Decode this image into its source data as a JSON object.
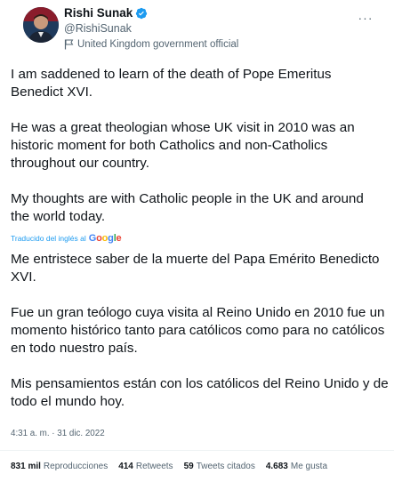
{
  "author": {
    "display_name": "Rishi Sunak",
    "handle": "@RishiSunak",
    "label": "United Kingdom government official",
    "verified": true
  },
  "icons": {
    "verified": "verified-badge-icon",
    "label": "flag-icon",
    "more": "more-icon"
  },
  "tweet": {
    "text": "I am saddened to learn of the death of Pope Emeritus Benedict XVI.\n\nHe was a great theologian whose UK visit in 2010 was an historic moment for both Catholics and non-Catholics throughout our country.\n\nMy thoughts are with Catholic people in the UK and around the world today.",
    "translated_by_label": "Traducido del inglés al",
    "translation_service": "Google",
    "translation": "Me entristece saber de la muerte del Papa Emérito Benedicto XVI.\n\nFue un gran teólogo cuya visita al Reino Unido en 2010 fue un momento histórico tanto para católicos como para no católicos en todo nuestro país.\n\nMis pensamientos están con los católicos del Reino Unido y de todo el mundo hoy.",
    "timestamp": "4:31 a. m. · 31 dic. 2022"
  },
  "stats": [
    {
      "value": "831 mil",
      "label": "Reproducciones"
    },
    {
      "value": "414",
      "label": "Retweets"
    },
    {
      "value": "59",
      "label": "Tweets citados"
    },
    {
      "value": "4.683",
      "label": "Me gusta"
    }
  ],
  "colors": {
    "accent": "#1d9bf0",
    "text": "#0f1419",
    "secondary": "#536471",
    "divider": "#eff3f4"
  }
}
